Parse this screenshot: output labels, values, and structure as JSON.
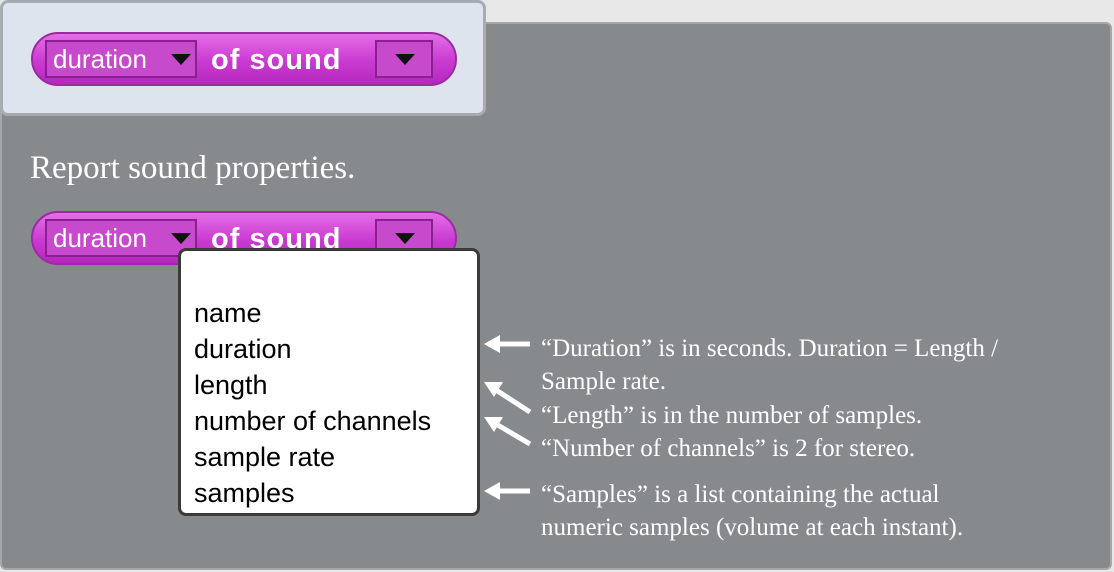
{
  "example_block": {
    "attribute_value": "duration",
    "text": "of sound"
  },
  "description": "Report sound properties.",
  "dropdown_block": {
    "attribute_value": "duration",
    "text": "of sound"
  },
  "menu": {
    "items": [
      "name",
      "duration",
      "length",
      "number of channels",
      "sample rate",
      "samples"
    ]
  },
  "notes": {
    "duration": [
      "“Duration” is in seconds. Duration = Length /",
      "Sample rate."
    ],
    "length": "“Length” is in the number of samples.",
    "channels": "“Number of channels” is 2 for stereo.",
    "samples": [
      "“Samples” is a list containing the actual",
      "numeric samples (volume at each instant)."
    ]
  },
  "colors": {
    "block_magenta": "#c93ad0",
    "panel_gray": "#868a8c",
    "frame_blue": "#dde4ee"
  }
}
